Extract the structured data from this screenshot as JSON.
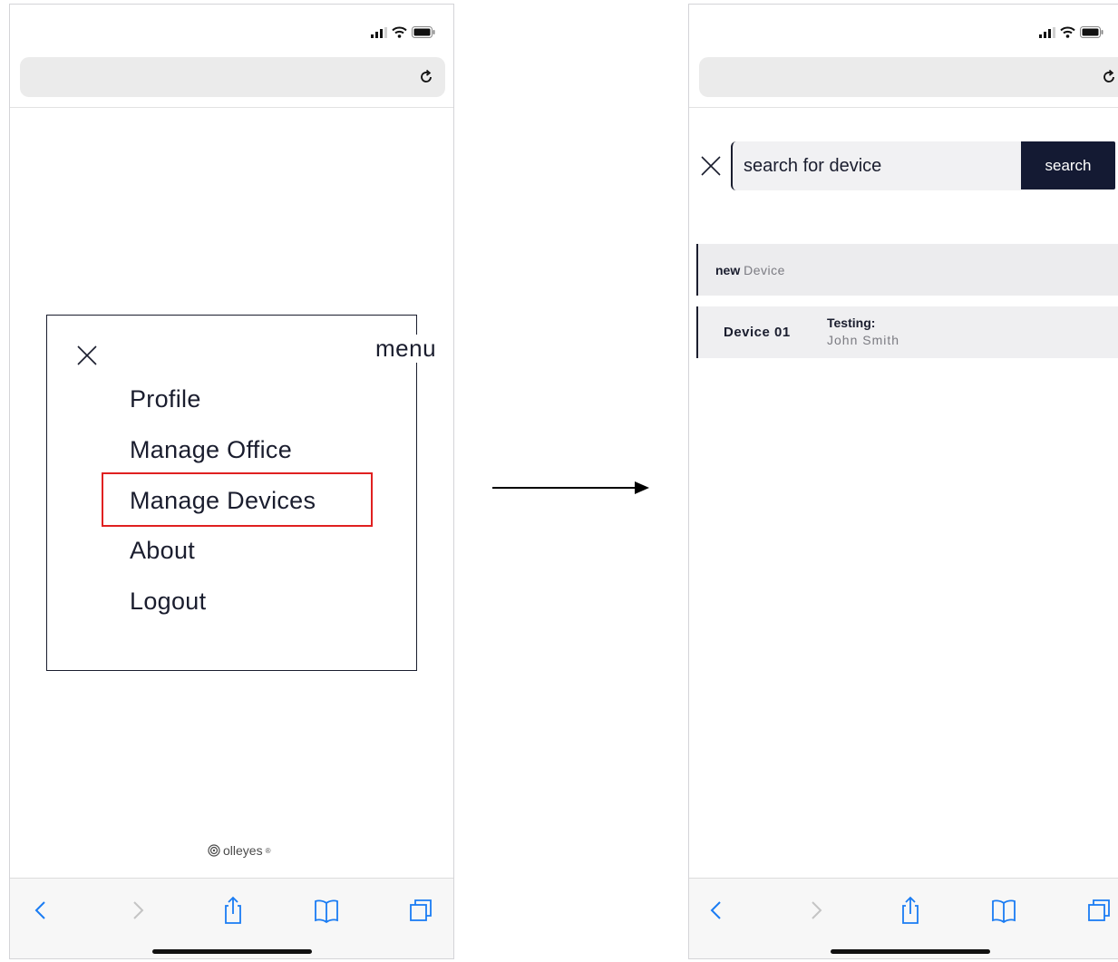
{
  "menu_screen": {
    "menu_label": "menu",
    "items": [
      {
        "label": "Profile"
      },
      {
        "label": "Manage Office"
      },
      {
        "label": "Manage Devices",
        "highlighted": true
      },
      {
        "label": "About"
      },
      {
        "label": "Logout"
      }
    ],
    "brand": "olleyes",
    "brand_mark": "®"
  },
  "device_screen": {
    "search": {
      "placeholder": "search for device",
      "value": "",
      "button_label": "search"
    },
    "new_device": {
      "prefix": "new",
      "label": "Device"
    },
    "devices": [
      {
        "name": "Device 01",
        "status_label": "Testing:",
        "user": "John Smith"
      }
    ]
  },
  "icons": {
    "status": [
      "signal-icon",
      "wifi-icon",
      "battery-icon"
    ],
    "toolbar": [
      "back-icon",
      "forward-icon",
      "share-icon",
      "bookmarks-icon",
      "tabs-icon"
    ],
    "reload": "reload-icon",
    "close": "close-icon"
  },
  "colors": {
    "highlight": "#e02020",
    "search_button": "#141a33",
    "text_dark": "#1a1d2e",
    "toolbar_blue": "#1a7cf3"
  }
}
